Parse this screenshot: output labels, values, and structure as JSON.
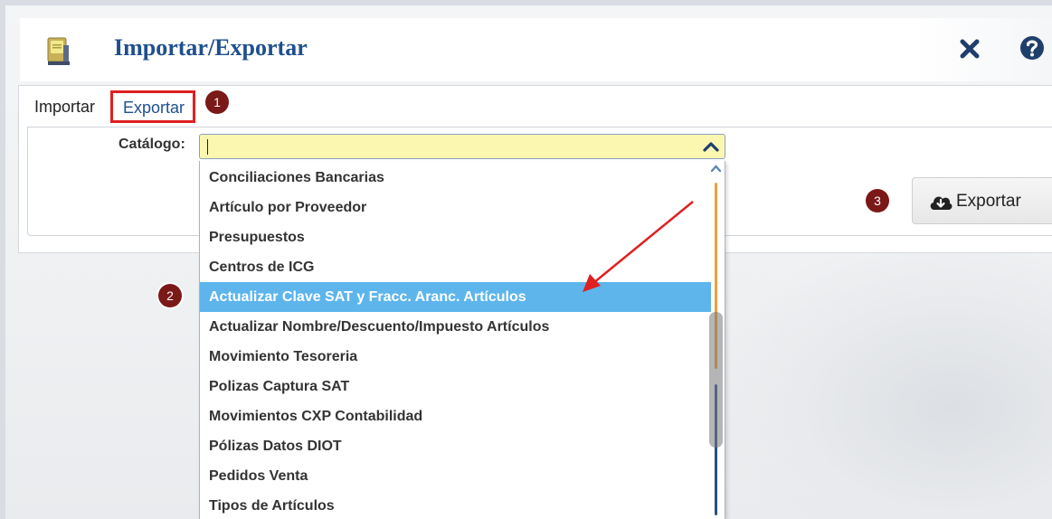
{
  "window": {
    "title": "Importar/Exportar",
    "close_icon": "close-icon",
    "help_icon": "help-icon"
  },
  "tabs": [
    {
      "label": "Importar",
      "active": false
    },
    {
      "label": "Exportar",
      "active": true
    }
  ],
  "annotations": {
    "step1": "1",
    "step2": "2",
    "step3": "3",
    "highlight_color": "#e02020",
    "badge_color": "#7b1818"
  },
  "form": {
    "catalog_label": "Catálogo:",
    "catalog_value": "",
    "export_button": "Exportar",
    "export_icon": "cloud-download-icon"
  },
  "dropdown": {
    "options": [
      "Conciliaciones Bancarias",
      "Artículo por Proveedor",
      "Presupuestos",
      "Centros de ICG",
      "Actualizar Clave SAT y Fracc. Aranc. Artículos",
      "Actualizar Nombre/Descuento/Impuesto Artículos",
      "Movimiento Tesoreria",
      "Polizas Captura SAT",
      "Movimientos CXP Contabilidad",
      "Pólizas Datos DIOT",
      "Pedidos Venta",
      "Tipos de Artículos"
    ],
    "selected_index": 4,
    "selected_color": "#5db5ec"
  }
}
